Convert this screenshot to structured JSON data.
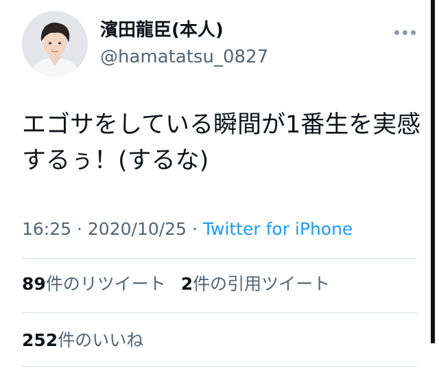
{
  "user": {
    "display_name": "濱田龍臣(本人)",
    "handle": "@hamatatsu_0827",
    "avatar_icon": "profile-photo"
  },
  "menu": {
    "icon": "more-horizontal-icon"
  },
  "tweet": {
    "text": "エゴサをしている瞬間が1番生を実感するぅ！(するな)"
  },
  "meta": {
    "time": "16:25",
    "separator": "·",
    "date": "2020/10/25",
    "source": "Twitter for iPhone"
  },
  "stats": {
    "retweets_count": "89",
    "retweets_label": "件のリツイート",
    "quotes_count": "2",
    "quotes_label": "件の引用ツイート",
    "likes_count": "252",
    "likes_label": "件のいいね"
  },
  "colors": {
    "text": "#0f1419",
    "secondary": "#536471",
    "link": "#1d9bf0",
    "divider": "#cfd9de"
  }
}
